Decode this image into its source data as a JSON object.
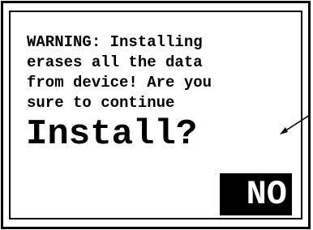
{
  "dialog": {
    "warning_lines": [
      "WARNING: Installing",
      "erases all the data",
      "from device! Are you",
      "sure to continue"
    ],
    "prompt": "Install?",
    "no_label": "NO",
    "pointer_icon": "arrow-pointer-icon"
  }
}
